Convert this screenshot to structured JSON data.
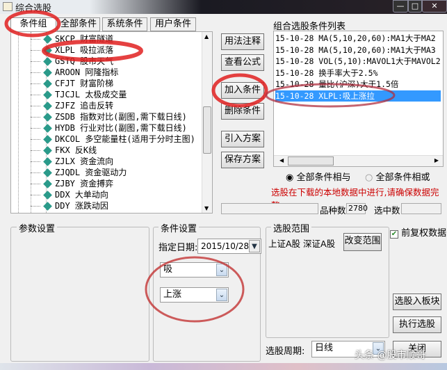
{
  "window": {
    "title": "综合选股",
    "minimize": "—",
    "maximize": "□",
    "close": "✕"
  },
  "tabs": [
    {
      "label": "条件组"
    },
    {
      "label": "全部条件"
    },
    {
      "label": "系统条件"
    },
    {
      "label": "用户条件"
    }
  ],
  "tree_items": [
    {
      "label": "SKCP 财富隧道"
    },
    {
      "label": "XLPL 吸拉派落"
    },
    {
      "label": "GSTQ 股市天气"
    },
    {
      "label": "AROON 阿隆指标"
    },
    {
      "label": "CFJT 财富阶梯"
    },
    {
      "label": "TJCJL 太极成交量"
    },
    {
      "label": "ZJFZ 追击反转"
    },
    {
      "label": "ZSDB 指数对比(副图,需下载日线)"
    },
    {
      "label": "HYDB 行业对比(副图,需下载日线)"
    },
    {
      "label": "DKCOL 多空能量柱(适用于分时主图)"
    },
    {
      "label": "FKX 反K线"
    },
    {
      "label": "ZJLX 资金流向"
    },
    {
      "label": "ZJQDL 资金驱动力"
    },
    {
      "label": "ZJBY 资金搏弈"
    },
    {
      "label": "DDX 大单动向"
    },
    {
      "label": "DDY 涨跌动因"
    }
  ],
  "side_buttons": {
    "usage": "用法注释",
    "formula": "查看公式",
    "add": "加入条件",
    "delete": "删除条件",
    "import": "引入方案",
    "save": "保存方案"
  },
  "condition_list": {
    "title": "组合选股条件列表",
    "rows": [
      "15-10-28 MA(5,10,20,60):MA1大于MA2",
      "15-10-28 MA(5,10,20,60):MA1大于MA3",
      "15-10-28 VOL(5,10):MAVOL1大于MAVOL2",
      "15-10-28 换手率大于2.5%",
      "15-10-28 量比(沪深)大于1.5倍",
      "15-10-28 XLPL:吸上涨拉"
    ],
    "selected_index": 5
  },
  "logic": {
    "and_label": "全部条件相与",
    "or_label": "全部条件相或",
    "selected": "and"
  },
  "warning": "选股在下载的本地数据中进行,请确保数据完整",
  "stats": {
    "count_label": "品种数",
    "count_value": "2780",
    "selected_label": "选中数",
    "selected_value": ""
  },
  "params": {
    "title": "参数设置"
  },
  "condition_settings": {
    "title": "条件设置",
    "date_label": "指定日期:",
    "date_value": "2015/10/28",
    "combo1": "吸",
    "combo2": "上涨"
  },
  "range": {
    "title": "选股范围",
    "markets": "上证A股 深证A股",
    "change_button": "改变范围"
  },
  "adjust": {
    "label": "前复权数据",
    "checked": true
  },
  "actions": {
    "to_block": "选股入板块",
    "execute": "执行选股",
    "close": "关闭"
  },
  "period": {
    "label": "选股周期:",
    "value": "日线"
  },
  "watermark": "头条 @股市顺哥"
}
